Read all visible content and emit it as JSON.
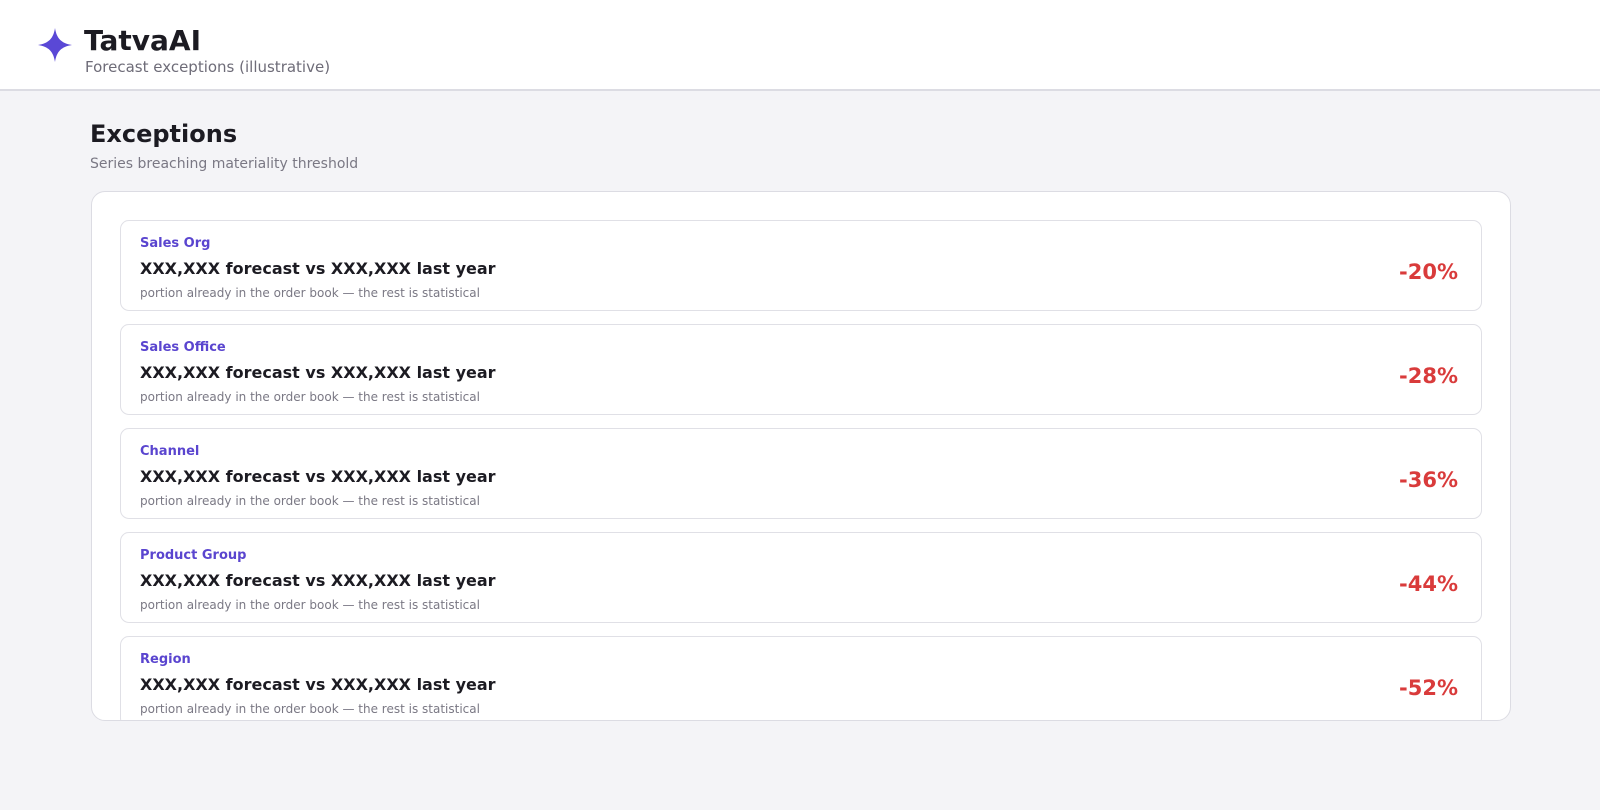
{
  "header": {
    "brand": "TatvaAI",
    "subtitle": "Forecast exceptions (illustrative)",
    "logo_icon": "four-point-star-icon",
    "accent_color": "#5a45cf"
  },
  "main": {
    "title": "Exceptions",
    "subtitle": "Series breaching materiality threshold",
    "exceptions": [
      {
        "category": "Sales Org",
        "title": "XXX,XXX forecast vs XXX,XXX last year",
        "note": "portion already in the order book — the rest is statistical",
        "change": "-20%"
      },
      {
        "category": "Sales Office",
        "title": "XXX,XXX forecast vs XXX,XXX last year",
        "note": "portion already in the order book — the rest is statistical",
        "change": "-28%"
      },
      {
        "category": "Channel",
        "title": "XXX,XXX forecast vs XXX,XXX last year",
        "note": "portion already in the order book — the rest is statistical",
        "change": "-36%"
      },
      {
        "category": "Product Group",
        "title": "XXX,XXX forecast vs XXX,XXX last year",
        "note": "portion already in the order book — the rest is statistical",
        "change": "-44%"
      },
      {
        "category": "Region",
        "title": "XXX,XXX forecast vs XXX,XXX last year",
        "note": "portion already in the order book — the rest is statistical",
        "change": "-52%"
      }
    ],
    "negative_color": "#d93b3b"
  }
}
